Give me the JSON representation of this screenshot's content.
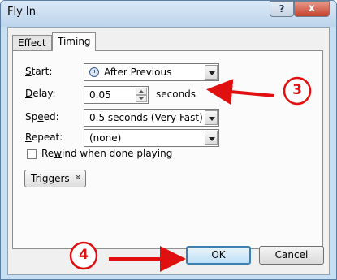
{
  "window": {
    "title": "Fly In",
    "help_glyph": "?",
    "close_glyph": "x"
  },
  "tabs": [
    {
      "label": "Effect",
      "active": false
    },
    {
      "label": "Timing",
      "active": true
    }
  ],
  "fields": {
    "start": {
      "label_ul": "S",
      "label_rest": "tart:",
      "value": "After Previous",
      "icon": "clock-icon"
    },
    "delay": {
      "label_ul": "D",
      "label_rest": "elay:",
      "value": "0.05",
      "unit": "seconds"
    },
    "speed": {
      "label_pre": "Sp",
      "label_ul": "e",
      "label_rest": "ed:",
      "value": "0.5 seconds (Very Fast)"
    },
    "repeat": {
      "label_ul": "R",
      "label_rest": "epeat:",
      "value": "(none)"
    }
  },
  "rewind": {
    "label_pre": "Re",
    "label_ul": "w",
    "label_rest": "ind when done playing",
    "checked": false
  },
  "triggers": {
    "label_ul": "T",
    "label_rest": "riggers",
    "chevron": "»"
  },
  "buttons": {
    "ok": "OK",
    "cancel": "Cancel"
  },
  "annotations": [
    {
      "number": "3",
      "color": "#e01010"
    },
    {
      "number": "4",
      "color": "#e01010"
    }
  ]
}
